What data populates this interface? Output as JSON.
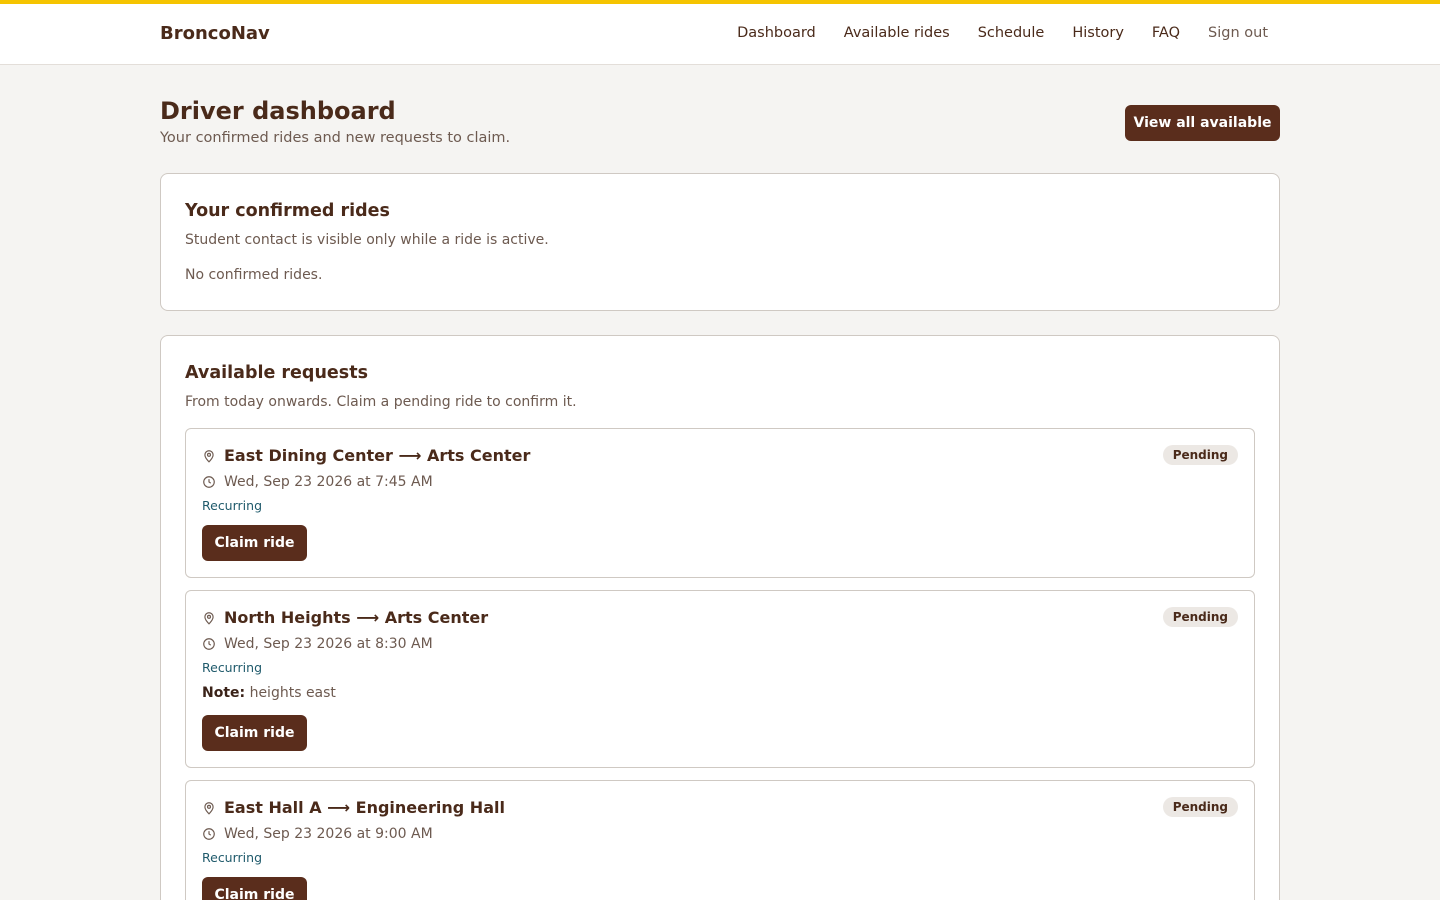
{
  "brand": "BroncoNav",
  "nav": {
    "dashboard": "Dashboard",
    "available": "Available rides",
    "schedule": "Schedule",
    "history": "History",
    "faq": "FAQ",
    "signout": "Sign out"
  },
  "header": {
    "title": "Driver dashboard",
    "subtitle": "Your confirmed rides and new requests to claim.",
    "view_all": "View all available"
  },
  "confirmed": {
    "title": "Your confirmed rides",
    "subtitle": "Student contact is visible only while a ride is active.",
    "empty": "No confirmed rides."
  },
  "available": {
    "title": "Available requests",
    "subtitle": "From today onwards. Claim a pending ride to confirm it.",
    "rides": [
      {
        "route": "East Dining Center ⟶ Arts Center",
        "time": "Wed, Sep 23 2026 at 7:45 AM",
        "recurring": "Recurring",
        "status": "Pending",
        "claim": "Claim ride"
      },
      {
        "route": "North Heights ⟶ Arts Center",
        "time": "Wed, Sep 23 2026 at 8:30 AM",
        "recurring": "Recurring",
        "note_label": "Note:",
        "note": " heights east",
        "status": "Pending",
        "claim": "Claim ride"
      },
      {
        "route": "East Hall A ⟶ Engineering Hall",
        "time": "Wed, Sep 23 2026 at 9:00 AM",
        "recurring": "Recurring",
        "status": "Pending",
        "claim": "Claim ride"
      }
    ]
  },
  "colors": {
    "accent_bar": "#f5c400",
    "primary": "#5a2d1c",
    "recurring": "#1f5a6b"
  },
  "icons": {
    "location": "map-pin-icon",
    "time": "clock-icon"
  }
}
